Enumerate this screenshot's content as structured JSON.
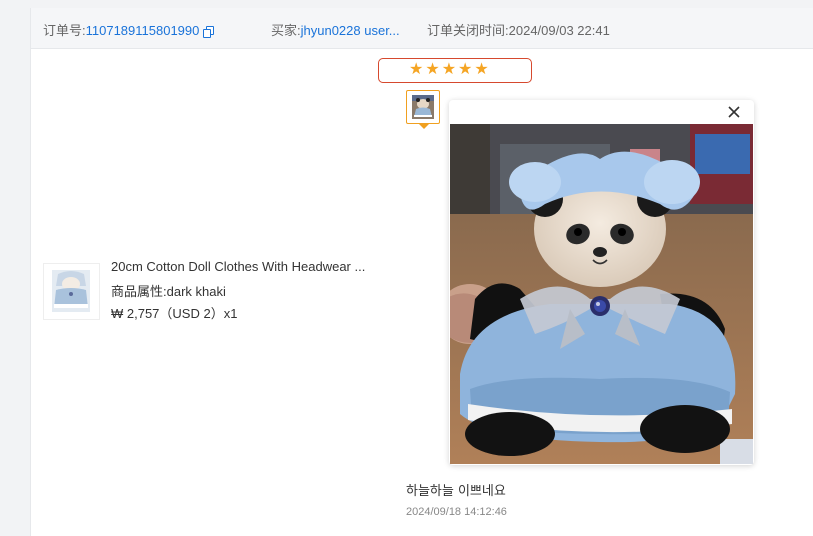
{
  "order_header": {
    "order_no_label": "订单号:",
    "order_no": "1107189115801990",
    "buyer_label": "买家:",
    "buyer": "jhyun0228 user...",
    "closed_time_label": "订单关闭时间:",
    "closed_time": "2024/09/03 22:41"
  },
  "rating": {
    "stars": 5,
    "stars_text": "★★★★★"
  },
  "product": {
    "title": "20cm Cotton Doll Clothes With Headwear ...",
    "attr_label": "商品属性:",
    "attr_value": "dark khaki",
    "price": "₩ 2,757（USD  2）x1"
  },
  "review": {
    "text": "하늘하늘 이쁘네요",
    "time": "2024/09/18 14:12:46"
  },
  "preview": {
    "close_icon": "close-icon"
  },
  "colors": {
    "link": "#1a73d9",
    "star": "#f5a524",
    "highlight_border": "#d6492e",
    "thumb_border": "#f0a020"
  }
}
